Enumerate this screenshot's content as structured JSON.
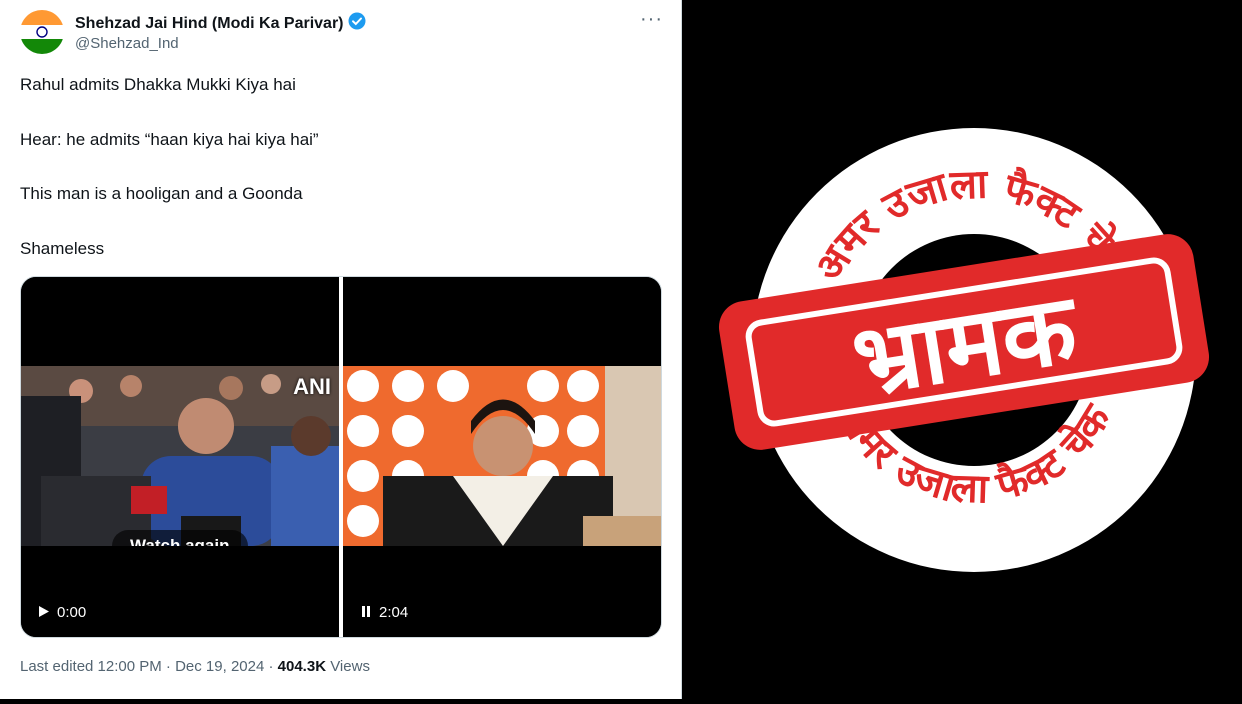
{
  "tweet": {
    "display_name": "Shehzad Jai Hind (Modi Ka Parivar)",
    "handle": "@Shehzad_Ind",
    "lines": [
      "Rahul admits Dhakka Mukki Kiya hai",
      "Hear: he admits “haan kiya hai kiya hai”",
      "This man is a hooligan and a Goonda",
      "Shameless"
    ],
    "media": {
      "left": {
        "watermark": "ANI",
        "overlay_label": "Watch again",
        "time": "0:00"
      },
      "right": {
        "time": "2:04"
      }
    },
    "footer": {
      "edited": "Last edited 12:00 PM · Dec 19, 2024 · ",
      "views_count": "404.3K",
      "views_label": " Views"
    }
  },
  "stamp": {
    "top_arc": "अमर उजाला फैक्ट चेक",
    "bottom_arc": "अमर उजाला फैक्ट चेक",
    "verdict": "भ्रामक",
    "colors": {
      "red": "#e12a2a",
      "white": "#ffffff",
      "bg": "#000000"
    }
  },
  "icons": [
    "verified-badge-icon",
    "more-icon",
    "play-icon",
    "pause-icon",
    "avatar-flag"
  ]
}
